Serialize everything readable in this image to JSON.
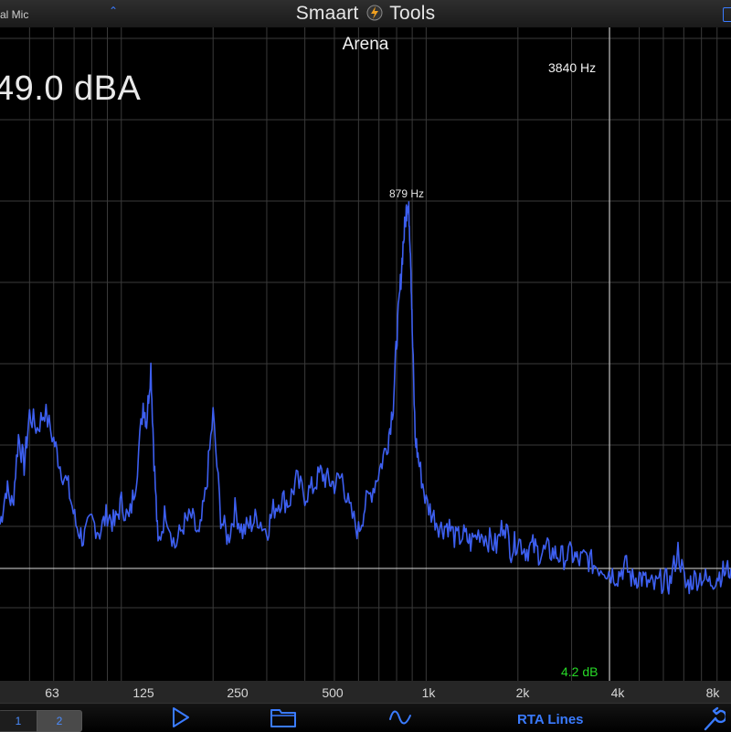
{
  "header": {
    "input_label": "al Mic",
    "title_left": "Smaart",
    "title_right": "Tools",
    "caret_icon": "chevron-up-icon"
  },
  "display": {
    "trace_name": "Arena",
    "level_readout": "49.0 dBA",
    "cursor_freq": "3840 Hz",
    "peak_label": "879 Hz",
    "db_readout": "4.2 dB"
  },
  "axis": {
    "ticks": [
      "63",
      "125",
      "250",
      "500",
      "1k",
      "2k",
      "4k",
      "8k"
    ]
  },
  "toolbar": {
    "seg1": "1",
    "seg2": "2",
    "mode_label": "RTA Lines",
    "icons": [
      "play-icon",
      "folder-icon",
      "waveform-icon",
      "wrench-icon"
    ]
  },
  "colors": {
    "trace": "#3d5ff0",
    "grid": "#3a3a3a",
    "accent": "#3a7bff",
    "db_text": "#27d927"
  },
  "chart_data": {
    "type": "line",
    "x_scale": "log",
    "xlim": [
      40,
      10000
    ],
    "x_ticks": [
      "63",
      "125",
      "250",
      "500",
      "1k",
      "2k",
      "4k",
      "8k"
    ],
    "peak_freq_hz": 879,
    "cursor_freq_hz": 3840,
    "series": [
      {
        "freq_hz": [
          40,
          42,
          44,
          46,
          48,
          50,
          53,
          56,
          60,
          63,
          67,
          71,
          75,
          80,
          85,
          90,
          95,
          100,
          106,
          112,
          118,
          121,
          125,
          128,
          132,
          140,
          150,
          160,
          170,
          180,
          190,
          200,
          212,
          224,
          236,
          250,
          265,
          280,
          300,
          315,
          335,
          355,
          375,
          400,
          425,
          450,
          475,
          500,
          530,
          560,
          600,
          630,
          670,
          710,
          750,
          780,
          800,
          820,
          840,
          860,
          870,
          879,
          890,
          900,
          920,
          950,
          1000,
          1060,
          1120,
          1180,
          1250,
          1330,
          1400,
          1500,
          1600,
          1700,
          1800,
          1900,
          2000,
          2120,
          2240,
          2360,
          2500,
          2650,
          2800,
          3000,
          3150,
          3350,
          3550,
          3840,
          4000,
          4250,
          4500,
          4750,
          5000,
          5300,
          5600,
          6000,
          6300,
          6700,
          7100,
          7500,
          8000,
          8500,
          9000,
          9500,
          10000
        ],
        "level": [
          0.12,
          0.22,
          0.17,
          0.36,
          0.28,
          0.42,
          0.38,
          0.43,
          0.35,
          0.28,
          0.22,
          0.12,
          0.08,
          0.13,
          0.1,
          0.15,
          0.12,
          0.18,
          0.13,
          0.25,
          0.45,
          0.4,
          0.55,
          0.3,
          0.06,
          0.16,
          0.06,
          0.12,
          0.14,
          0.08,
          0.22,
          0.42,
          0.14,
          0.08,
          0.16,
          0.1,
          0.12,
          0.14,
          0.1,
          0.16,
          0.19,
          0.18,
          0.24,
          0.2,
          0.22,
          0.26,
          0.24,
          0.23,
          0.25,
          0.16,
          0.1,
          0.17,
          0.22,
          0.28,
          0.35,
          0.45,
          0.62,
          0.75,
          0.88,
          0.97,
          1.0,
          0.96,
          0.85,
          0.65,
          0.36,
          0.28,
          0.18,
          0.14,
          0.11,
          0.12,
          0.08,
          0.09,
          0.07,
          0.1,
          0.08,
          0.06,
          0.13,
          0.05,
          0.08,
          0.05,
          0.06,
          0.04,
          0.05,
          0.04,
          0.03,
          0.04,
          0.02,
          0.03,
          0.01,
          0.0,
          -0.01,
          -0.02,
          0.01,
          -0.03,
          -0.02,
          -0.04,
          -0.05,
          -0.03,
          -0.04,
          0.05,
          -0.05,
          -0.03,
          -0.02,
          -0.04,
          -0.02,
          -0.01,
          0.0
        ]
      }
    ]
  }
}
